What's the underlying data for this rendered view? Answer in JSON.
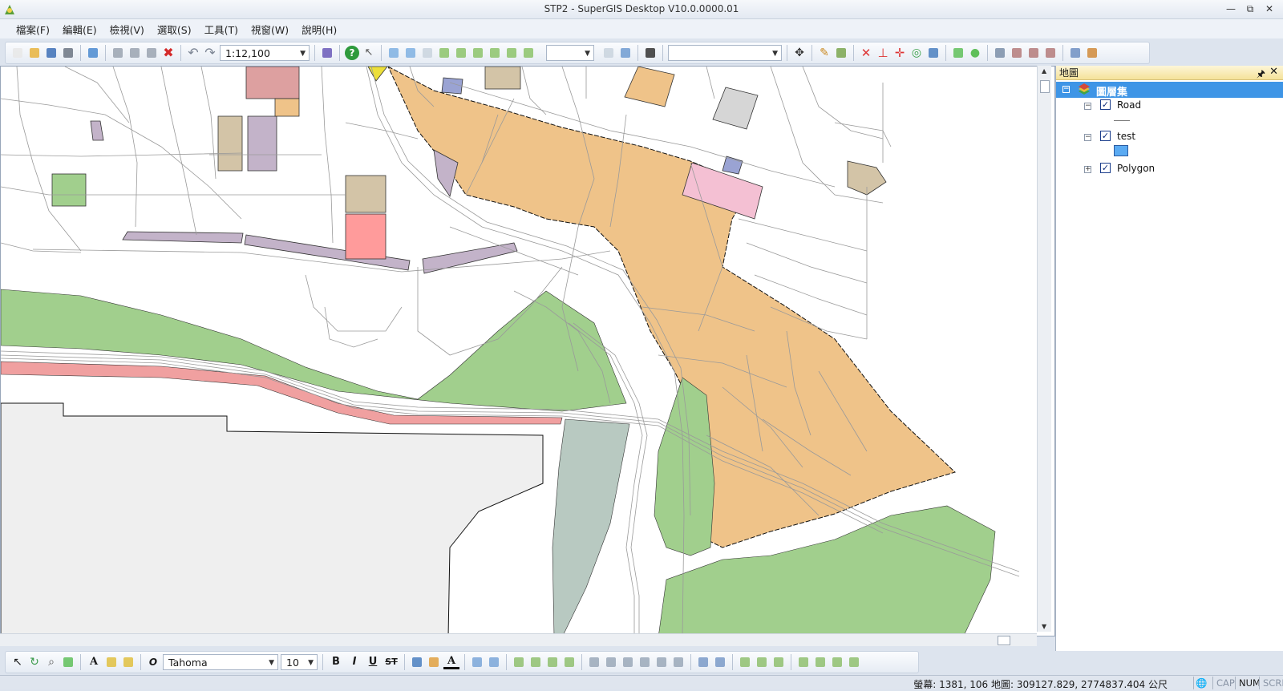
{
  "window": {
    "title": "STP2 - SuperGIS Desktop V10.0.0000.01",
    "controls": [
      "minimize",
      "restore",
      "close"
    ]
  },
  "menu": [
    "檔案(F)",
    "編輯(E)",
    "檢視(V)",
    "選取(S)",
    "工具(T)",
    "視窗(W)",
    "說明(H)"
  ],
  "toolbar": {
    "scale_value": "1:12,100",
    "blank_combo_1": "",
    "blank_combo_2": ""
  },
  "map": {
    "colors": {
      "orange": "#efc389",
      "green": "#a1cf8d",
      "pink": "#f4c0d3",
      "lavender": "#c3b3c9",
      "tan": "#d3c4a7",
      "salmon": "#ff9b9b",
      "rosy": "#f0a0a0",
      "gray": "#efefef",
      "slate": "#b8c9c1",
      "blue": "#9aa3d3",
      "road": "#9a9a9a"
    }
  },
  "layers_panel": {
    "title": "地圖",
    "root_label": "圖層集",
    "layers": [
      {
        "name": "Road",
        "checked": true,
        "expanded": true,
        "symbol": "line"
      },
      {
        "name": "test",
        "checked": true,
        "expanded": true,
        "symbol": "fill",
        "symbol_color": "#5aaaf2"
      },
      {
        "name": "Polygon",
        "checked": true,
        "expanded": false
      }
    ]
  },
  "format_toolbar": {
    "font_family": "Tahoma",
    "font_size": "10",
    "bold": "B",
    "italic": "I",
    "underline": "U",
    "strikethrough": "ST",
    "text_tool": "A"
  },
  "status": {
    "coords_text": "螢幕: 1381, 106  地圖: 309127.829, 2774837.404 公尺",
    "cap": "CAP",
    "num": "NUM",
    "scrl": "SCRL"
  }
}
